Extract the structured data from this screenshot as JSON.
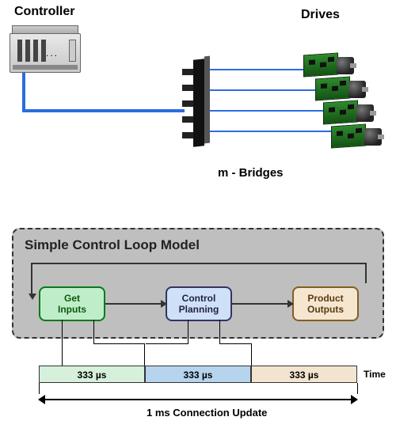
{
  "top": {
    "controller_label": "Controller",
    "drives_label": "Drives",
    "bridges_label": "m - Bridges",
    "drive_count": 4
  },
  "model": {
    "title": "Simple Control Loop Model",
    "stages": [
      {
        "label": "Get\nInputs"
      },
      {
        "label": "Control\nPlanning"
      },
      {
        "label": "Product\nOutputs"
      }
    ]
  },
  "timeline": {
    "segments": [
      "333 µs",
      "333 µs",
      "333 µs"
    ],
    "axis_label": "Time",
    "total_label": "1 ms Connection Update"
  }
}
